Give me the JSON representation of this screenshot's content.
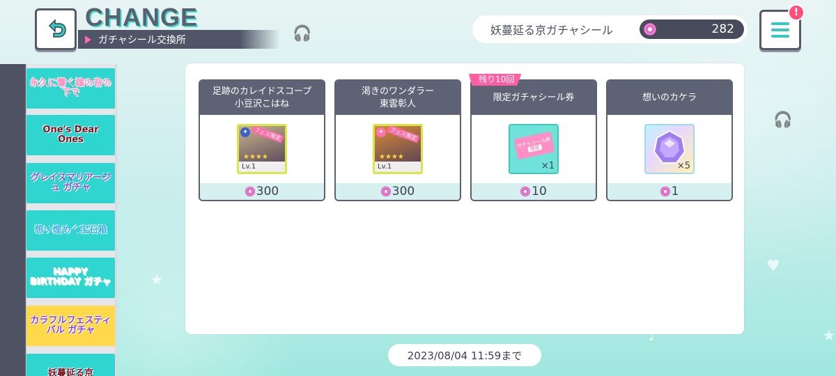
{
  "header": {
    "title": "CHANGE",
    "subtitle": "ガチャシール交換所"
  },
  "currency": {
    "name": "妖蔓延る京ガチャシール",
    "amount": "282"
  },
  "menu": {
    "badge": "!"
  },
  "sidebar": {
    "banners": [
      {
        "label": "永久に響く鐘の音の下で",
        "bg": "#2fd6cf",
        "fg": "#ff8fbf"
      },
      {
        "label": "One's Dear Ones",
        "bg": "#2fd6cf",
        "fg": "#7a1020"
      },
      {
        "label": "グレイスマリアージュ ガチャ",
        "bg": "#2fd6cf",
        "fg": "#7b4fd6"
      },
      {
        "label": "想い煌めく宝石箱",
        "bg": "#2fd6cf",
        "fg": "#3ab0e8"
      },
      {
        "label": "HAPPY BIRTHDAY ガチャ",
        "bg": "#2fd6cf",
        "fg": "#ffffff"
      },
      {
        "label": "カラフルフェスティバル ガチャ",
        "bg": "#ffd94a",
        "fg": "#8a3fd8"
      },
      {
        "label": "妖蔓延る京",
        "bg": "#2fd6cf",
        "fg": "#7a1020"
      }
    ]
  },
  "cards": [
    {
      "title_line1": "足跡のカレイドスコープ",
      "title_line2": "小豆沢こはね",
      "type": "character",
      "fes_tag": "フェス限定",
      "stars": "★★★★",
      "level": "Lv.1",
      "cost": "300",
      "thumb_color": "#c9b48a"
    },
    {
      "title_line1": "渇きのワンダラー",
      "title_line2": "東雲彰人",
      "type": "character",
      "fes_tag": "フェス限定",
      "stars": "★★★★",
      "level": "Lv.1",
      "cost": "300",
      "thumb_color": "#d98a3a"
    },
    {
      "title_line1": "限定ガチャシール券",
      "title_line2": "",
      "type": "ticket",
      "ticket_text": "ガチャシール券",
      "ticket_sub": "限定",
      "quantity": "×1",
      "cost": "10",
      "remaining": "残り10回"
    },
    {
      "title_line1": "想いのカケラ",
      "title_line2": "",
      "type": "crystal",
      "quantity": "×5",
      "cost": "1"
    }
  ],
  "deadline": "2023/08/04 11:59まで"
}
